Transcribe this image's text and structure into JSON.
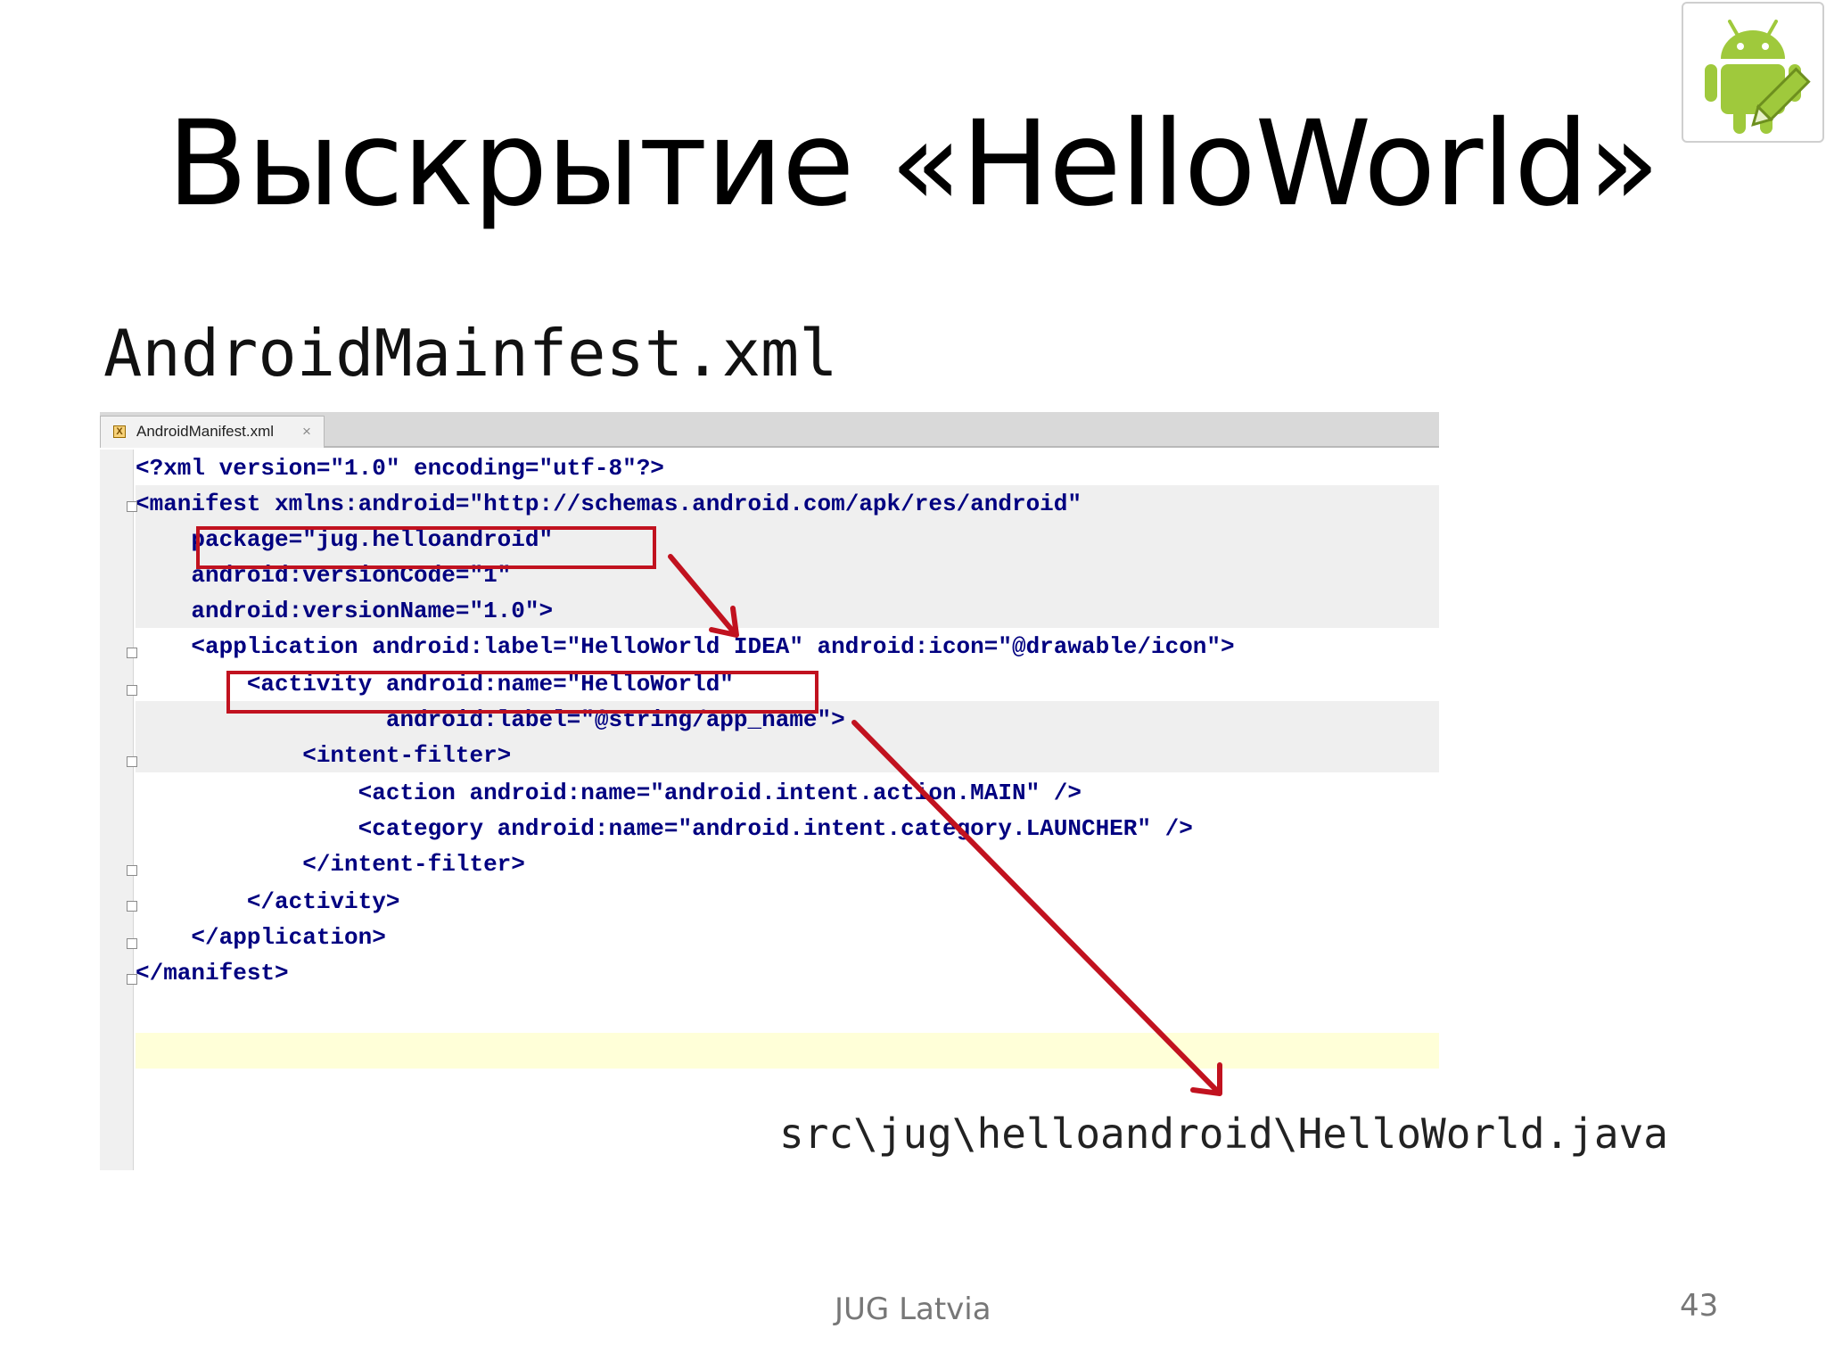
{
  "slide": {
    "title": "Выскрытие «HelloWorld»",
    "subtitle": "AndroidMainfest.xml",
    "path_label": "src\\jug\\helloandroid\\HelloWorld.java",
    "footer": "JUG Latvia",
    "page_number": "43",
    "logo_icon": "android-robot-icon"
  },
  "editor": {
    "tab_label": "AndroidManifest.xml",
    "tab_close": "×",
    "tab_icon_glyph": "X",
    "lines": [
      "<?xml version=\"1.0\" encoding=\"utf-8\"?>",
      "<manifest xmlns:android=\"http://schemas.android.com/apk/res/android\"",
      "    package=\"jug.helloandroid\"",
      "    android:versionCode=\"1\"",
      "    android:versionName=\"1.0\">",
      "    <application android:label=\"HelloWorld IDEA\" android:icon=\"@drawable/icon\">",
      "        <activity android:name=\"HelloWorld\"",
      "                  android:label=\"@string/app_name\">",
      "            <intent-filter>",
      "                <action android:name=\"android.intent.action.MAIN\" />",
      "                <category android:name=\"android.intent.category.LAUNCHER\" />",
      "            </intent-filter>",
      "        </activity>",
      "    </application>",
      "</manifest>"
    ]
  },
  "colors": {
    "highlight": "#c1121f",
    "tag": "#000080",
    "value": "#008000"
  }
}
